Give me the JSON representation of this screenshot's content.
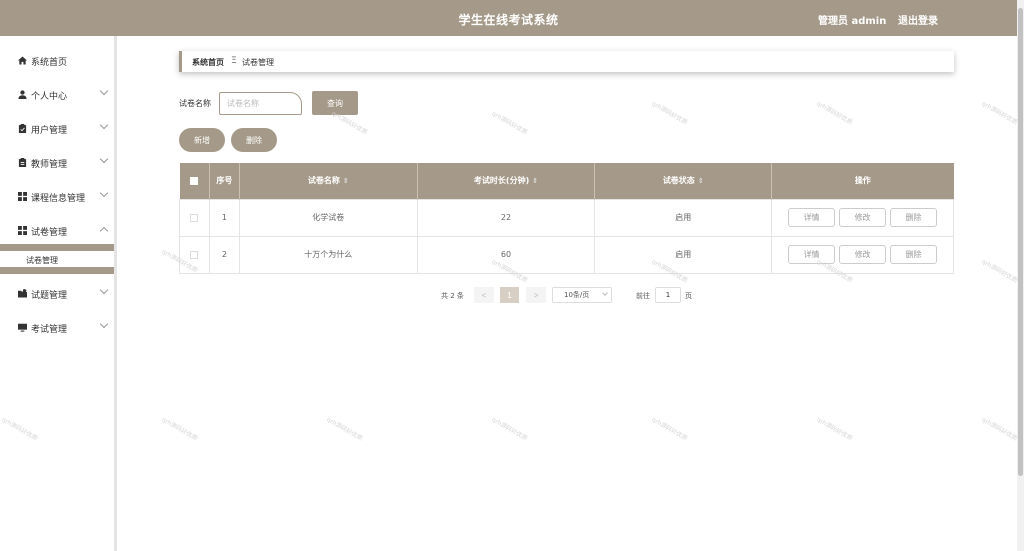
{
  "header": {
    "title": "学生在线考试系统",
    "admin": "管理员 admin",
    "logout": "退出登录"
  },
  "sidebar": {
    "items": [
      {
        "label": "系统首页",
        "icon": "home-icon"
      },
      {
        "label": "个人中心",
        "icon": "user-icon"
      },
      {
        "label": "用户管理",
        "icon": "clipboard-icon"
      },
      {
        "label": "教师管理",
        "icon": "clipboard-icon"
      },
      {
        "label": "课程信息管理",
        "icon": "grid-icon"
      },
      {
        "label": "试卷管理",
        "icon": "grid-icon"
      },
      {
        "label": "试题管理",
        "icon": "folder-icon"
      },
      {
        "label": "考试管理",
        "icon": "monitor-icon"
      }
    ],
    "submenu": {
      "label": "试卷管理"
    }
  },
  "breadcrumb": {
    "home": "系统首页",
    "separator": "Ξ",
    "current": "试卷管理"
  },
  "search": {
    "label": "试卷名称",
    "placeholder": "试卷名称",
    "value": "",
    "button": "查询"
  },
  "actions": {
    "add": "新增",
    "delete": "删除"
  },
  "table": {
    "headers": {
      "index": "序号",
      "name": "试卷名称",
      "duration": "考试时长(分钟)",
      "status": "试卷状态",
      "ops": "操作"
    },
    "sort_glyph": "⇕",
    "op_labels": {
      "detail": "详情",
      "edit": "修改",
      "delete": "删除"
    },
    "rows": [
      {
        "index": "1",
        "name": "化学试卷",
        "duration": "22",
        "status": "启用"
      },
      {
        "index": "2",
        "name": "十万个为什么",
        "duration": "60",
        "status": "启用"
      }
    ]
  },
  "pagination": {
    "total": "共 2 条",
    "prev": "<",
    "current_page": "1",
    "next": ">",
    "page_size": "10条/页",
    "goto_prefix": "前往",
    "goto_value": "1",
    "goto_suffix": "页"
  },
  "watermark": "qrh源码好优质",
  "colors": {
    "primary": "#a59a89",
    "active_page": "#d7cfc3"
  }
}
